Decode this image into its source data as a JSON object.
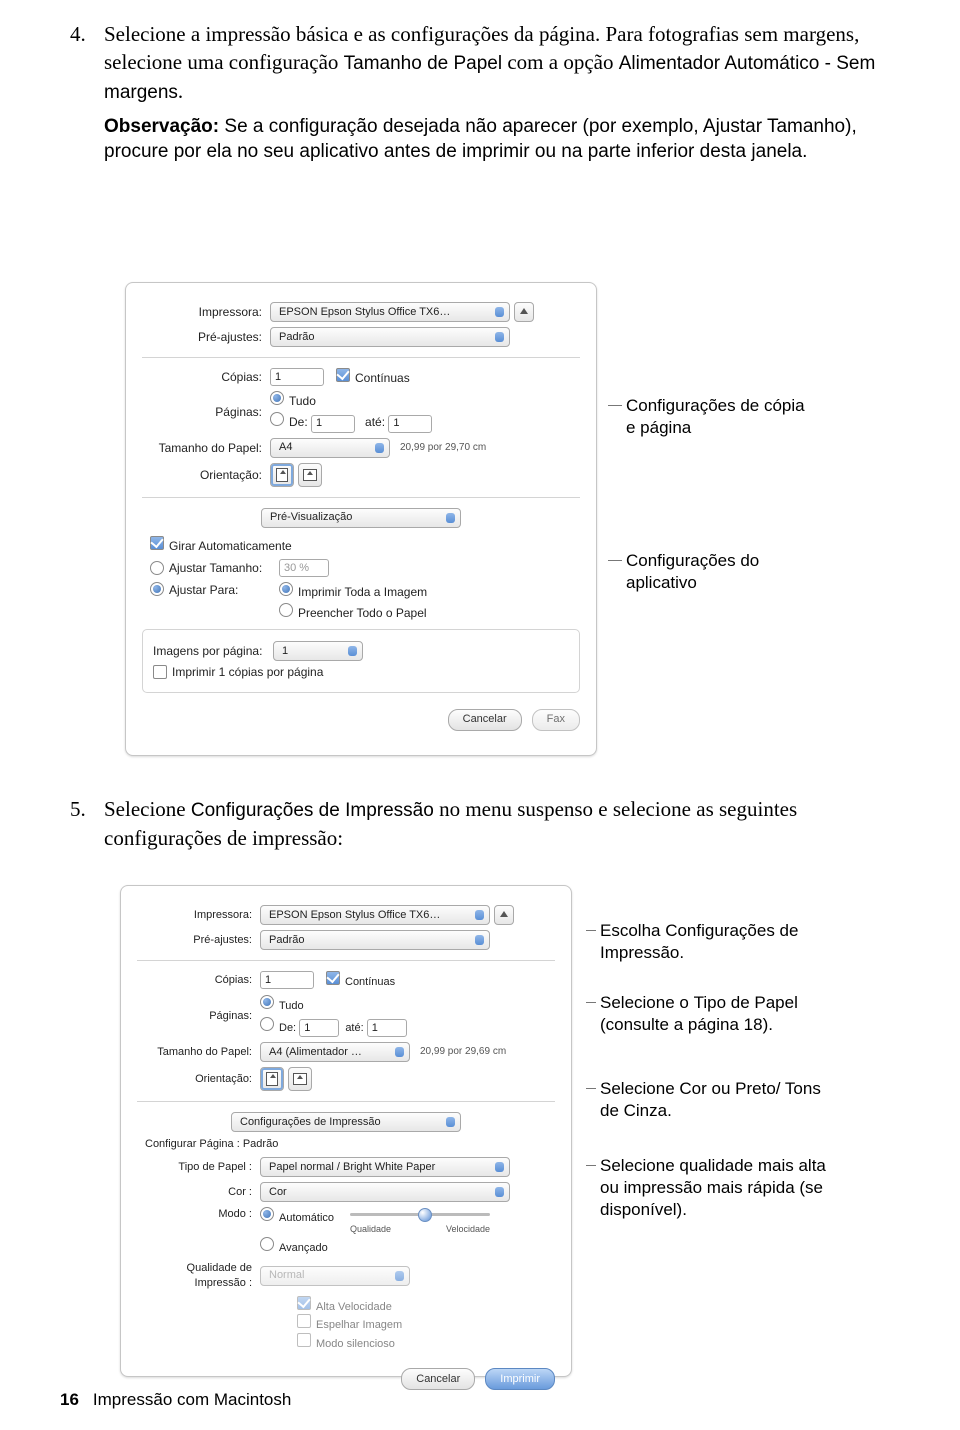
{
  "step4": {
    "num": "4.",
    "text_a": "Selecione a impressão básica e as configurações da página. Para fotografias sem margens, selecione uma configuração ",
    "bold_a": "Tamanho de Papel",
    "text_b": " com a opção ",
    "bold_b": "Alimentador Automático - Sem margens",
    "text_c": "."
  },
  "note": {
    "bold": "Observação:",
    "text_a": " Se a configuração desejada não aparecer (por exemplo, ",
    "bold_b": "Ajustar Tamanho",
    "text_b": "), procure por ela no seu aplicativo antes de imprimir ou na parte inferior desta janela."
  },
  "dlg1": {
    "impressora_lbl": "Impressora:",
    "impressora_val": "EPSON Epson Stylus Office TX6…",
    "preajustes_lbl": "Pré-ajustes:",
    "preajustes_val": "Padrão",
    "copias_lbl": "Cópias:",
    "copias_val": "1",
    "continuas": "Contínuas",
    "paginas_lbl": "Páginas:",
    "tudo": "Tudo",
    "de": "De:",
    "de_val": "1",
    "ate": "até:",
    "ate_val": "1",
    "tamanho_lbl": "Tamanho do Papel:",
    "tamanho_val": "A4",
    "tamanho_size": "20,99 por 29,70 cm",
    "orient_lbl": "Orientação:",
    "section": "Pré-Visualização",
    "girar": "Girar Automaticamente",
    "ajtam": "Ajustar Tamanho:",
    "ajtam_val": "30 %",
    "ajpara": "Ajustar Para:",
    "imp_toda": "Imprimir Toda a Imagem",
    "preencher": "Preencher Todo o Papel",
    "img_por_pag_lbl": "Imagens por página:",
    "img_por_pag_val": "1",
    "imp_copias": "Imprimir 1 cópias por página",
    "cancelar": "Cancelar",
    "fax": "Fax"
  },
  "callouts1": {
    "a": "Configurações de cópia e página",
    "b": "Configurações do aplicativo"
  },
  "step5": {
    "num": "5.",
    "text_a": "Selecione ",
    "bold_a": "Configurações de Impressão",
    "text_b": " no menu suspenso e selecione as seguintes configurações de impressão:"
  },
  "dlg2": {
    "impressora_lbl": "Impressora:",
    "impressora_val": "EPSON Epson Stylus Office TX6…",
    "preajustes_lbl": "Pré-ajustes:",
    "preajustes_val": "Padrão",
    "copias_lbl": "Cópias:",
    "copias_val": "1",
    "continuas": "Contínuas",
    "paginas_lbl": "Páginas:",
    "tudo": "Tudo",
    "de": "De:",
    "de_val": "1",
    "ate": "até:",
    "ate_val": "1",
    "tamanho_lbl": "Tamanho do Papel:",
    "tamanho_val": "A4 (Alimentador …",
    "tamanho_size": "20,99 por 29,69 cm",
    "orient_lbl": "Orientação:",
    "section": "Configurações de Impressão",
    "config_pag": "Configurar Página : Padrão",
    "tipo_lbl": "Tipo de Papel :",
    "tipo_val": "Papel normal / Bright White Paper",
    "cor_lbl": "Cor :",
    "cor_val": "Cor",
    "modo_lbl": "Modo :",
    "modo_auto": "Automático",
    "modo_av": "Avançado",
    "qual": "Qualidade",
    "vel": "Velocidade",
    "qimp_lbl": "Qualidade de Impressão :",
    "qimp_val": "Normal",
    "alta_vel": "Alta Velocidade",
    "espelhar": "Espelhar Imagem",
    "silencioso": "Modo silencioso",
    "cancelar": "Cancelar",
    "imprimir": "Imprimir"
  },
  "callouts2": {
    "a_pre": "Escolha ",
    "a_bold": "Configurações de Impressão",
    "a_post": ".",
    "b_pre": "Selecione o ",
    "b_bold": "Tipo de Papel",
    "b_post": " (consulte a página 18).",
    "c_pre": "Selecione ",
    "c_bold1": "Cor",
    "c_mid": " ou ",
    "c_bold2": "Preto/ Tons de Cinza",
    "c_post": ".",
    "d": "Selecione qualidade mais alta ou impressão mais rápida (se disponível)."
  },
  "footer": {
    "page": "16",
    "title": "Impressão com Macintosh"
  }
}
